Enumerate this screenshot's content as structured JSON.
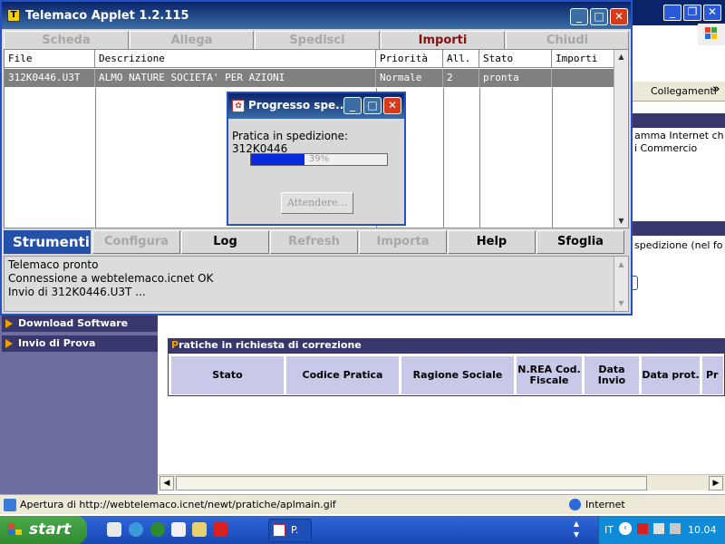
{
  "applet": {
    "title": "Telemaco Applet 1.2.115",
    "tabs": [
      {
        "label": "Scheda",
        "enabled": false
      },
      {
        "label": "Allega",
        "enabled": false
      },
      {
        "label": "Spedisci",
        "enabled": false
      },
      {
        "label": "Importi",
        "enabled": true
      },
      {
        "label": "Chiudi",
        "enabled": false
      }
    ],
    "table": {
      "headers": [
        "File",
        "Descrizione",
        "Priorità",
        "All.",
        "Stato",
        "Importi"
      ],
      "rows": [
        [
          "312K0446.U3T",
          "ALMO NATURE SOCIETA' PER AZIONI",
          "Normale",
          "2",
          "pronta",
          ""
        ]
      ]
    },
    "strumenti": {
      "label": "Strumenti",
      "buttons": [
        {
          "label": "Configura",
          "enabled": false
        },
        {
          "label": "Log",
          "enabled": true
        },
        {
          "label": "Refresh",
          "enabled": false
        },
        {
          "label": "Importa",
          "enabled": false
        },
        {
          "label": "Help",
          "enabled": true
        },
        {
          "label": "Sfoglia",
          "enabled": true
        }
      ]
    },
    "log_lines": [
      "Telemaco pronto",
      "Connessione a webtelemaco.icnet OK",
      "Invio di 312K0446.U3T ..."
    ]
  },
  "dialog": {
    "title": "Progresso spe...",
    "message": "Pratica in spedizione: 312K0446",
    "progress_percent": 39,
    "progress_label": "39%",
    "button": "Attendere..."
  },
  "browser": {
    "collegamenti": "Collegamenti",
    "right_text_1": "amma Internet ch",
    "right_text_2": "i Commercio",
    "right_text_3": "spedizione (nel fo",
    "left_menu": [
      "Download Software",
      "Invio di Prova"
    ],
    "pratiche": {
      "title_first": "P",
      "title_rest": "ratiche in richiesta di correzione",
      "columns": [
        "Stato",
        "Codice Pratica",
        "Ragione Sociale",
        "N.REA Cod. Fiscale",
        "Data Invio",
        "Data prot.",
        "Pr"
      ]
    },
    "status_text": "Apertura di http://webtelemaco.icnet/newt/pratiche/aplmain.gif",
    "zone": "Internet"
  },
  "taskbar": {
    "start": "start",
    "task_label": "P.",
    "lang": "IT",
    "clock": "10.04"
  },
  "colors": {
    "title_bar": "#0a246a",
    "accent_blue": "#2450a8",
    "progress_fill": "#0a2ae0",
    "active_tab": "#8a1010",
    "nav_dark": "#38386e"
  }
}
